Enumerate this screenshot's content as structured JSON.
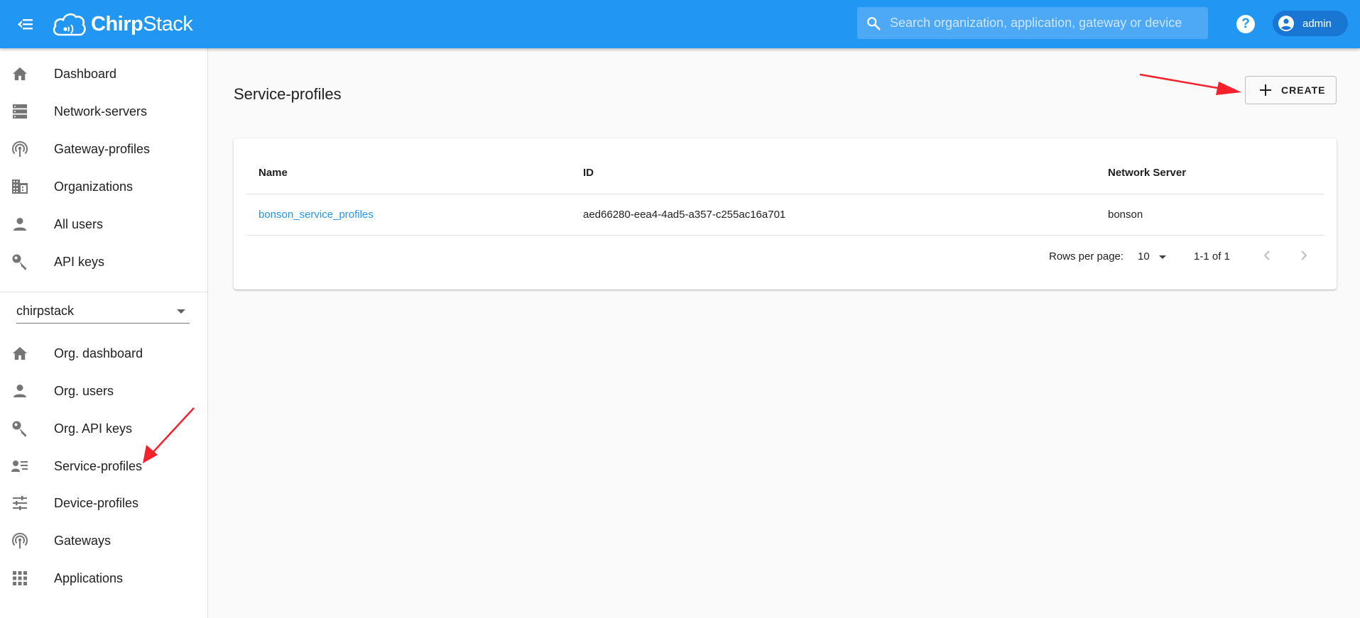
{
  "header": {
    "logo_text_bold": "Chirp",
    "logo_text_rest": "Stack",
    "search_placeholder": "Search organization, application, gateway or device",
    "help_label": "?",
    "user_name": "admin",
    "brand_color": "#2196f3"
  },
  "sidebar": {
    "global_items": [
      {
        "label": "Dashboard",
        "icon": "home-icon"
      },
      {
        "label": "Network-servers",
        "icon": "server-icon"
      },
      {
        "label": "Gateway-profiles",
        "icon": "antenna-icon"
      },
      {
        "label": "Organizations",
        "icon": "domain-icon"
      },
      {
        "label": "All users",
        "icon": "person-icon"
      },
      {
        "label": "API keys",
        "icon": "key-icon"
      }
    ],
    "org_selector": {
      "value": "chirpstack"
    },
    "org_items": [
      {
        "label": "Org. dashboard",
        "icon": "home-icon"
      },
      {
        "label": "Org. users",
        "icon": "person-icon"
      },
      {
        "label": "Org. API keys",
        "icon": "key-icon"
      },
      {
        "label": "Service-profiles",
        "icon": "account-details-icon"
      },
      {
        "label": "Device-profiles",
        "icon": "tune-icon"
      },
      {
        "label": "Gateways",
        "icon": "antenna-icon"
      },
      {
        "label": "Applications",
        "icon": "apps-icon"
      }
    ]
  },
  "main": {
    "title": "Service-profiles",
    "create_label": "CREATE",
    "table": {
      "columns": [
        "Name",
        "ID",
        "Network Server"
      ],
      "rows": [
        {
          "name": "bonson_service_profiles",
          "id": "aed66280-eea4-4ad5-a357-c255ac16a701",
          "network_server": "bonson"
        }
      ]
    },
    "pagination": {
      "rows_per_page_label": "Rows per page:",
      "rows_per_page": "10",
      "range": "1-1 of 1"
    }
  },
  "annotation_color": "#f5222d"
}
